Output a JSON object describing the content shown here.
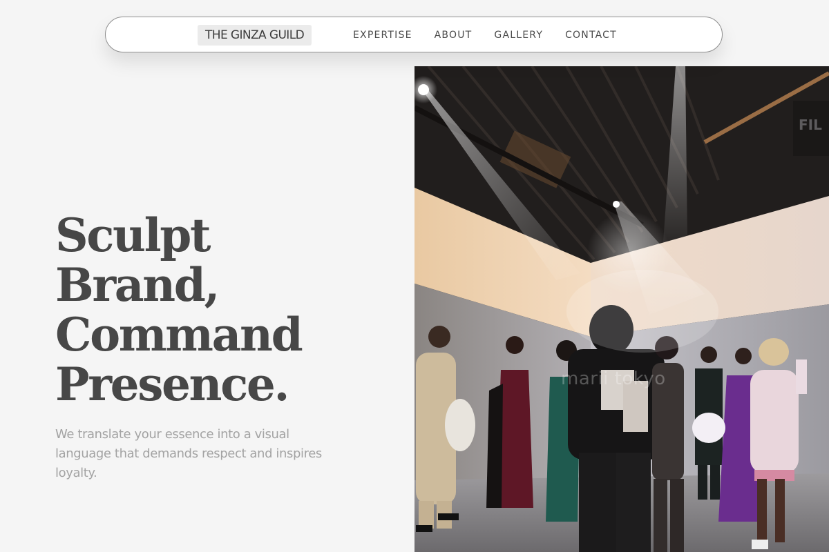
{
  "nav": {
    "brand": "THE GINZA GUILD",
    "links": [
      "EXPERTISE",
      "ABOUT",
      "GALLERY",
      "CONTACT"
    ]
  },
  "hero": {
    "title_lines": [
      "Sculpt",
      "Brand,",
      "Command",
      "Presence."
    ],
    "subtitle": "We translate your essence into a visual language that demands respect and inspires loyalty."
  },
  "photo": {
    "watermark": "marii tokyo",
    "sign_text": "FIL"
  },
  "colors": {
    "page_bg": "#f5f5f5",
    "heading": "#474747",
    "subtext": "#a3a3a3",
    "nav_text": "#4a4a4a",
    "brand_bg": "#ebebeb"
  }
}
